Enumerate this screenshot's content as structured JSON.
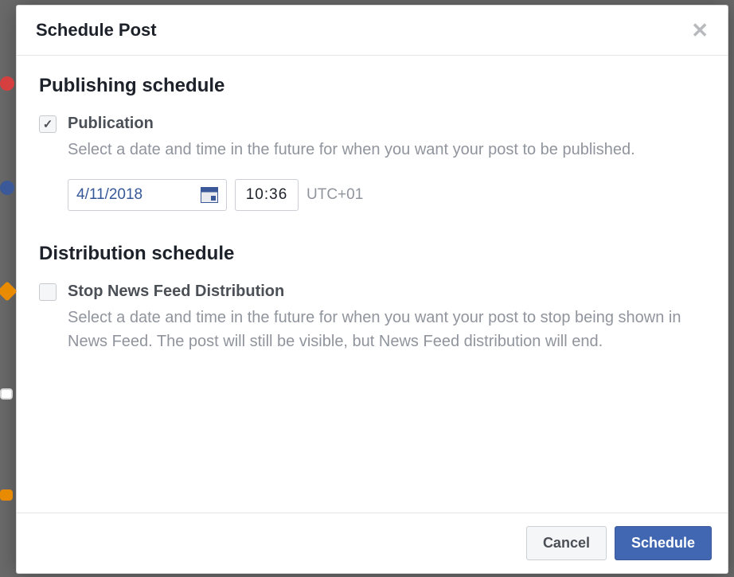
{
  "dialog": {
    "title": "Schedule Post"
  },
  "publishing": {
    "heading": "Publishing schedule",
    "option_label": "Publication",
    "option_desc": "Select a date and time in the future for when you want your post to be published.",
    "date": "4/11/2018",
    "time": "10:36",
    "timezone": "UTC+01",
    "checked": true
  },
  "distribution": {
    "heading": "Distribution schedule",
    "option_label": "Stop News Feed Distribution",
    "option_desc": "Select a date and time in the future for when you want your post to stop being shown in News Feed. The post will still be visible, but News Feed distribution will end.",
    "checked": false
  },
  "footer": {
    "cancel": "Cancel",
    "schedule": "Schedule"
  }
}
